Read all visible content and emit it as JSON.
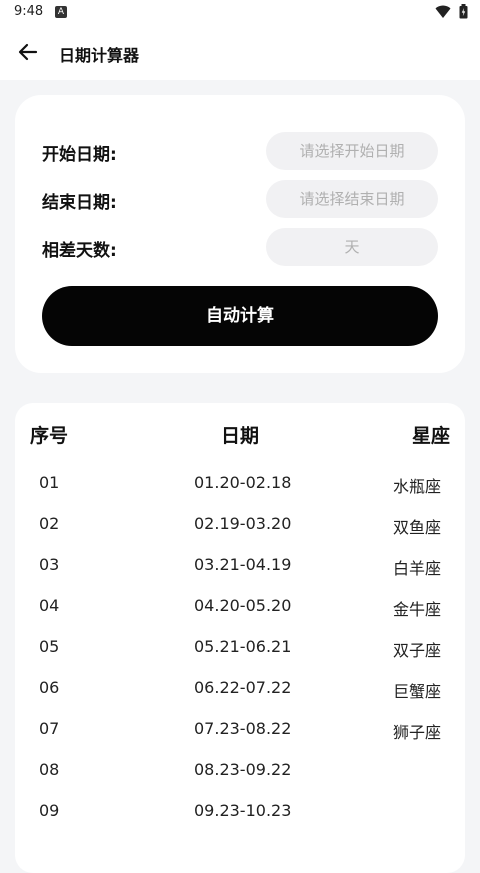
{
  "status_bar": {
    "time": "9:48",
    "badge": "A"
  },
  "app_bar": {
    "title": "日期计算器"
  },
  "calculator": {
    "start_label": "开始日期:",
    "start_placeholder": "请选择开始日期",
    "end_label": "结束日期:",
    "end_placeholder": "请选择结束日期",
    "diff_label": "相差天数:",
    "diff_unit": "天",
    "button_label": "自动计算"
  },
  "table": {
    "headers": {
      "index": "序号",
      "date": "日期",
      "sign": "星座"
    },
    "rows": [
      {
        "index": "01",
        "date": "01.20-02.18",
        "sign": "水瓶座"
      },
      {
        "index": "02",
        "date": "02.19-03.20",
        "sign": "双鱼座"
      },
      {
        "index": "03",
        "date": "03.21-04.19",
        "sign": "白羊座"
      },
      {
        "index": "04",
        "date": "04.20-05.20",
        "sign": "金牛座"
      },
      {
        "index": "05",
        "date": "05.21-06.21",
        "sign": "双子座"
      },
      {
        "index": "06",
        "date": "06.22-07.22",
        "sign": "巨蟹座"
      },
      {
        "index": "07",
        "date": "07.23-08.22",
        "sign": "狮子座"
      },
      {
        "index": "08",
        "date": "08.23-09.22",
        "sign": ""
      },
      {
        "index": "09",
        "date": "09.23-10.23",
        "sign": ""
      }
    ]
  }
}
